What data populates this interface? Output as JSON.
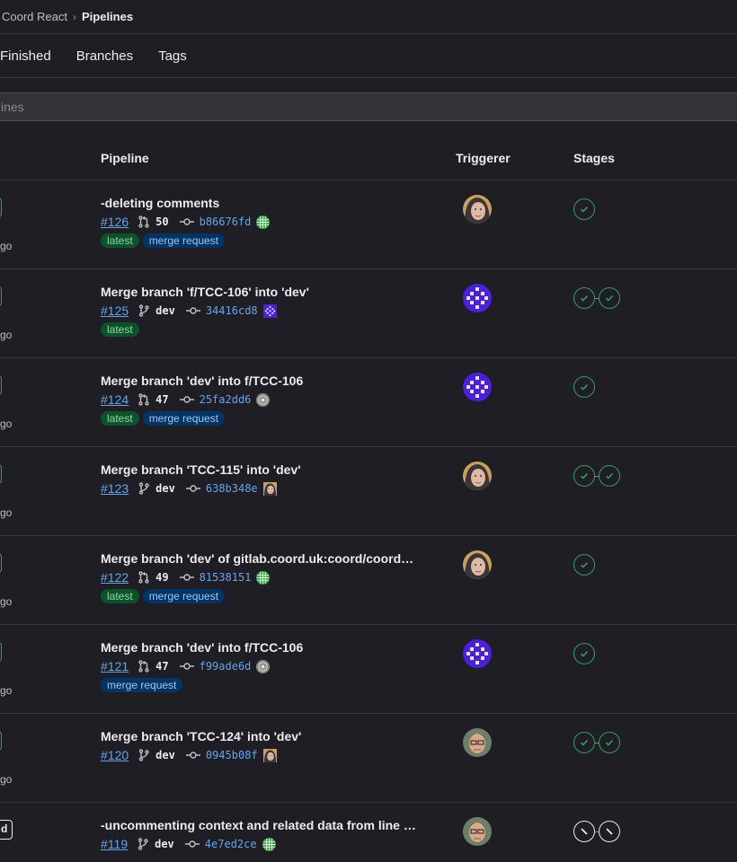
{
  "breadcrumb": {
    "parent": "Coord React",
    "separator": "›",
    "current": "Pipelines"
  },
  "tabs": [
    "Finished",
    "Branches",
    "Tags"
  ],
  "filter": {
    "placeholder": "ines"
  },
  "columns": {
    "pipeline": "Pipeline",
    "triggerer": "Triggerer",
    "stages": "Stages"
  },
  "colors": {
    "success": "#2da160",
    "link": "#63a6e9",
    "latest_bg": "#0d532a",
    "mr_bg": "#033464"
  },
  "rows": [
    {
      "ago": "go",
      "status": "passed",
      "title": "-deleting comments",
      "id": "#126",
      "ref_type": "merge-request",
      "ref": "50",
      "sha": "b86676fd",
      "badges": [
        "latest",
        "merge request"
      ],
      "triggerer": "woman-hijab",
      "commit_avatar": "green-grid",
      "stages": [
        "passed"
      ]
    },
    {
      "ago": "go",
      "status": "passed",
      "title": "Merge branch 'f/TCC-106' into 'dev'",
      "id": "#125",
      "ref_type": "branch",
      "ref": "dev",
      "sha": "34416cd8",
      "badges": [
        "latest"
      ],
      "triggerer": "purple-pattern",
      "commit_avatar": "purple-pattern",
      "stages": [
        "passed",
        "passed"
      ]
    },
    {
      "ago": "go",
      "status": "passed",
      "title": "Merge branch 'dev' into f/TCC-106",
      "id": "#124",
      "ref_type": "merge-request",
      "ref": "47",
      "sha": "25fa2dd6",
      "badges": [
        "latest",
        "merge request"
      ],
      "triggerer": "purple-pattern",
      "commit_avatar": "gray-pattern",
      "stages": [
        "passed"
      ]
    },
    {
      "ago": "go",
      "status": "passed",
      "title": "Merge branch 'TCC-115' into 'dev'",
      "id": "#123",
      "ref_type": "branch",
      "ref": "dev",
      "sha": "638b348e",
      "badges": [],
      "triggerer": "woman-hijab",
      "commit_avatar": "woman-hijab",
      "stages": [
        "passed",
        "passed"
      ]
    },
    {
      "ago": "go",
      "status": "passed",
      "title": "Merge branch 'dev' of gitlab.coord.uk:coord/coord…",
      "id": "#122",
      "ref_type": "merge-request",
      "ref": "49",
      "sha": "81538151",
      "badges": [
        "latest",
        "merge request"
      ],
      "triggerer": "woman-hijab",
      "commit_avatar": "green-grid",
      "stages": [
        "passed"
      ]
    },
    {
      "ago": "go",
      "status": "passed",
      "title": "Merge branch 'dev' into f/TCC-106",
      "id": "#121",
      "ref_type": "merge-request",
      "ref": "47",
      "sha": "f99ade6d",
      "badges": [
        "merge request"
      ],
      "triggerer": "purple-pattern",
      "commit_avatar": "gray-pattern",
      "stages": [
        "passed"
      ]
    },
    {
      "ago": "go",
      "status": "passed",
      "title": "Merge branch 'TCC-124' into 'dev'",
      "id": "#120",
      "ref_type": "branch",
      "ref": "dev",
      "sha": "0945b08f",
      "badges": [],
      "triggerer": "man-glasses",
      "commit_avatar": "woman-hijab",
      "stages": [
        "passed",
        "passed"
      ]
    },
    {
      "ago": "go",
      "status": "skipped",
      "title": "-uncommenting context and related data from line …",
      "id": "#119",
      "ref_type": "branch",
      "ref": "dev",
      "sha": "4e7ed2ce",
      "badges": [],
      "triggerer": "man-glasses",
      "commit_avatar": "green-grid",
      "stages": [
        "skipped",
        "skipped"
      ]
    }
  ]
}
